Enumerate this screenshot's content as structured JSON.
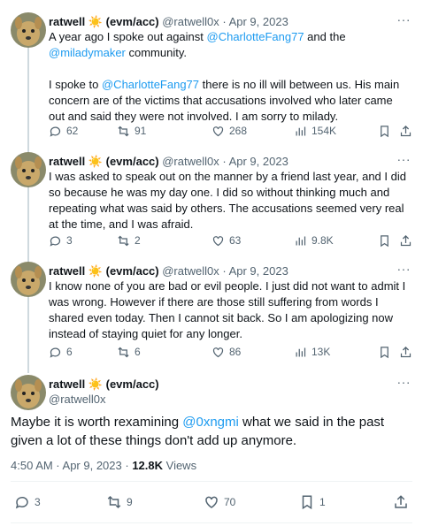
{
  "tweets": [
    {
      "name": "ratwell",
      "tag": "(evm/acc)",
      "handle": "@ratwell0x",
      "date": "Apr 9, 2023",
      "text_pre": "A year ago I spoke out against ",
      "mention1": "@CharlotteFang77",
      "text_mid": " and the ",
      "mention2": "@miladymaker",
      "text_post": " community.",
      "text2_pre": "I spoke to ",
      "text2_mention": "@CharlotteFang77",
      "text2_post": " there is no ill will between us. His main concern are of the victims that accusations involved who later came out and said they were not involved. I am sorry to milady.",
      "replies": "62",
      "retweets": "91",
      "likes": "268",
      "views": "154K"
    },
    {
      "name": "ratwell",
      "tag": "(evm/acc)",
      "handle": "@ratwell0x",
      "date": "Apr 9, 2023",
      "text": "I was asked to speak out on the manner by a friend last year, and I did so because he was my day one. I did so without thinking much and repeating what was said by others. The accusations seemed very real at the time, and I was afraid.",
      "replies": "3",
      "retweets": "2",
      "likes": "63",
      "views": "9.8K"
    },
    {
      "name": "ratwell",
      "tag": "(evm/acc)",
      "handle": "@ratwell0x",
      "date": "Apr 9, 2023",
      "text": "I know none of you are bad or evil people. I just did not want to admit I was wrong. However if there are those still suffering from words I shared even today. Then I cannot sit back. So I am apologizing now instead of staying quiet for any longer.",
      "replies": "6",
      "retweets": "6",
      "likes": "86",
      "views": "13K"
    }
  ],
  "main": {
    "name": "ratwell",
    "tag": "(evm/acc)",
    "handle": "@ratwell0x",
    "text_pre": "Maybe it is worth rexamining ",
    "mention": "@0xngmi",
    "text_post": " what we said in the past given a lot of these things don't add up anymore.",
    "time": "4:50 AM · Apr 9, 2023 · ",
    "views_count": "12.8K",
    "views_label": " Views",
    "replies": "3",
    "retweets": "9",
    "likes": "70",
    "bookmarks": "1"
  },
  "ui": {
    "more": "···",
    "dot": " · ",
    "sun": "☀️"
  },
  "colors": {
    "accent": "#1d9bf0",
    "muted": "#536471",
    "line": "#cfd9de"
  }
}
